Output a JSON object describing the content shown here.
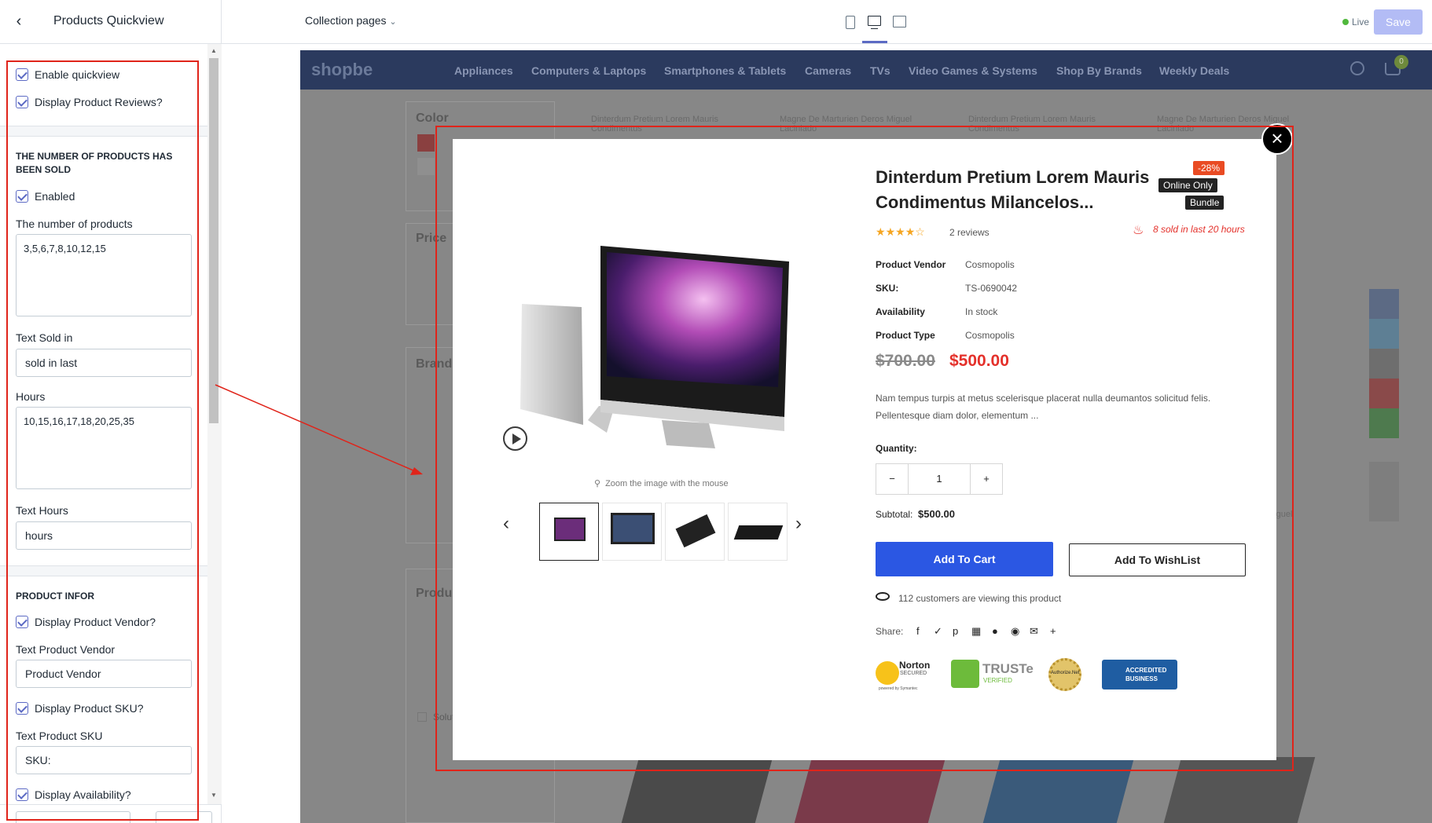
{
  "sidebar": {
    "title": "Products Quickview",
    "enable_quickview": "Enable quickview",
    "display_reviews": "Display Product Reviews?",
    "sold_heading": "THE NUMBER OF PRODUCTS HAS BEEN SOLD",
    "enabled": "Enabled",
    "number_label": "The number of products",
    "number_value": "3,5,6,7,8,10,12,15",
    "text_sold_label": "Text Sold in",
    "text_sold_value": "sold in last",
    "hours_label": "Hours",
    "hours_value": "10,15,16,17,18,20,25,35",
    "text_hours_label": "Text Hours",
    "text_hours_value": "hours",
    "infor_heading": "PRODUCT INFOR",
    "display_vendor": "Display Product Vendor?",
    "text_vendor_label": "Text Product Vendor",
    "text_vendor_value": "Product Vendor",
    "display_sku": "Display Product SKU?",
    "text_sku_label": "Text Product SKU",
    "text_sku_value": "SKU:",
    "display_availability": "Display Availability?"
  },
  "topbar": {
    "pages": "Collection pages",
    "live": "Live",
    "save": "Save"
  },
  "store": {
    "logo": "shopbe",
    "nav": [
      "Appliances",
      "Computers & Laptops",
      "Smartphones & Tablets",
      "Cameras",
      "TVs",
      "Video Games & Systems",
      "Shop By Brands",
      "Weekly Deals"
    ],
    "cart_count": "0",
    "filter_color": "Color",
    "filter_price": "Price",
    "filter_brand": "Brand",
    "filter_product": "Produ",
    "brand_item": "Solutmades",
    "product_titles": [
      "Dinterdum Pretium Lorem Mauris Condimentus",
      "Magne De Marturien Deros Miguel Laciniado",
      "Dinterdum Pretium Lorem Mauris Condimentus",
      "Magne De Marturien Deros Miguel Laciniado"
    ],
    "side_text": "Miguel"
  },
  "modal": {
    "badges": {
      "sale": "-28%",
      "online": "Online Only",
      "bundle": "Bundle"
    },
    "title": "Dinterdum Pretium Lorem Mauris Condimentus Milancelos...",
    "reviews": "2 reviews",
    "sold": "8 sold in last 20 hours",
    "meta": [
      {
        "k": "Product Vendor",
        "v": "Cosmopolis"
      },
      {
        "k": "SKU:",
        "v": "TS-0690042"
      },
      {
        "k": "Availability",
        "v": "In stock"
      },
      {
        "k": "Product Type",
        "v": "Cosmopolis"
      }
    ],
    "old_price": "$700.00",
    "new_price": "$500.00",
    "description": "Nam tempus turpis at metus scelerisque placerat nulla deumantos solicitud felis. Pellentesque diam dolor, elementum ...",
    "quantity_label": "Quantity:",
    "quantity": "1",
    "subtotal_label": "Subtotal:",
    "subtotal": "$500.00",
    "add_cart": "Add To Cart",
    "add_wishlist": "Add To WishList",
    "viewing": "112 customers are viewing this product",
    "share": "Share:",
    "zoom": "Zoom the image with the mouse",
    "trust": {
      "norton": "Norton",
      "norton_sub": "SECURED",
      "norton_pow": "powered by Symantec",
      "truste": "TRUSTe",
      "truste_sub": "VERIFIED",
      "authorize": "Authorize.Net",
      "bbb": "ACCREDITED BUSINESS"
    }
  },
  "colors": {
    "accent": "#2b57e3",
    "sale": "#e4312b",
    "annotation": "#e0241a"
  }
}
